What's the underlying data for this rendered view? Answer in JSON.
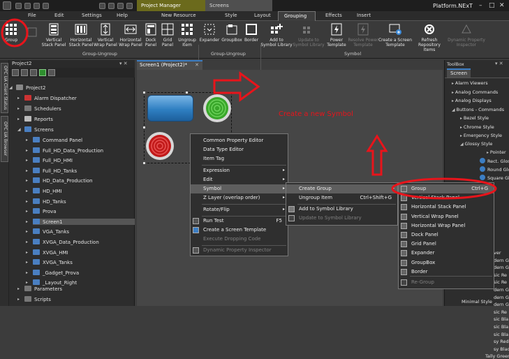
{
  "app": {
    "title": "Platform.NExT",
    "context_tab": "Project Manager",
    "doc_tab_group": "Screens"
  },
  "menu": [
    "File",
    "Edit",
    "Settings",
    "Help",
    "New Resource",
    "Style",
    "Layout",
    "Grouping",
    "Effects",
    "Insert"
  ],
  "ribbon": {
    "group_btn": "Group",
    "vertical_stack": "Vertical\nStack Panel",
    "horizontal_stack": "Horizontal\nStack Panel",
    "vertical_wrap": "Vertical\nWrap Panel",
    "horizontal_wrap": "Horizontal\nWrap Panel",
    "dock_panel": "Dock\nPanel",
    "grid_panel": "Grid\nPanel",
    "ungroup": "Ungroup\nItem",
    "expander": "Expander",
    "groupbox": "GroupBox",
    "border": "Border",
    "add_symbol": "Add to\nSymbol Library",
    "update_symbol": "Update to\nSymbol Library",
    "power_template": "Power\nTemplate",
    "resolve_template": "Resolve Power\nTemplate",
    "create_template": "Create a Screen\nTemplate",
    "refresh_repo": "Refresh\nRepository Items",
    "dyn_inspector": "Dynamic Property\nInspector",
    "group_label_1": "Group-Ungroup",
    "group_label_2": "Group-Ungroup",
    "group_label_3": "Symbol"
  },
  "side_tabs": {
    "opc_client": "OPC UA Client Status",
    "opc_browser": "OPC UA Browser"
  },
  "project": {
    "header": "Project2",
    "root": "Project2",
    "items": [
      "Alarm Dispatcher",
      "Schedulers",
      "Reports",
      "Screens"
    ],
    "screens": [
      "Command Panel",
      "Full_HD_Data_Production",
      "Full_HD_HMI",
      "Full_HD_Tanks",
      "HD_Data_Production",
      "HD_HMI",
      "HD_Tanks",
      "Prova",
      "Screen1",
      "VGA_Tanks",
      "XVGA_Data_Production",
      "XVGA_HMI",
      "XVGA_Tanks",
      "_Gadget_Prova",
      "_Layout_Right"
    ],
    "tail": [
      "Parameters",
      "Scripts"
    ]
  },
  "document": {
    "tab": "Screen1 (Project2)*",
    "annotation": "Create a new Symbol"
  },
  "toolbox": {
    "header": "ToolBox",
    "tab": "Screen",
    "items": [
      "Alarm Viewers",
      "Analog Commands",
      "Analog Displays",
      "Buttons - Commands",
      "Bezel Style",
      "Chrome Style",
      "Emergency Style",
      "Glossy Style",
      "Pointer",
      "Rect. Glos",
      "Round Glo",
      "Square Glo"
    ],
    "partial": [
      "ver",
      "dern Gl",
      "dern Gl",
      "sic Re",
      "sic Re",
      "dern Gl",
      "dern Gl",
      "dern Gl",
      "sic Re",
      "sic Bla",
      "sic Bla",
      "sic Bla",
      "sy Red I",
      "sy Black",
      "Tally Green"
    ],
    "minimal": "Minimal Style"
  },
  "context_menu": {
    "items": [
      "Common Property Editor",
      "Data Type Editor",
      "Item Tag",
      "Expression",
      "Edit",
      "Symbol",
      "Z Layer (overlap order)",
      "Rotate/Flip",
      "Run Test",
      "Create a Screen Template",
      "Execute Dropping Code",
      "Dynamic Property Inspector"
    ],
    "run_test_shortcut": "F5"
  },
  "symbol_menu": {
    "create_group": "Create Group",
    "ungroup_item": "Ungroup Item",
    "ungroup_shortcut": "Ctrl+Shift+G",
    "add_symbol": "Add to Symbol Library",
    "update_symbol": "Update to Symbol Library"
  },
  "group_menu": {
    "items": [
      "Group",
      "Vertical Stack Panel",
      "Horizontal Stack Panel",
      "Vertical Wrap Panel",
      "Horizontal Wrap Panel",
      "Dock Panel",
      "Grid Panel",
      "Expander",
      "GroupBox",
      "Border",
      "Re-Group"
    ],
    "group_shortcut": "Ctrl+G"
  },
  "colors": {
    "accent_red": "#e8141b",
    "highlight_green": "#2e8f2e",
    "canvas": "#464646"
  }
}
